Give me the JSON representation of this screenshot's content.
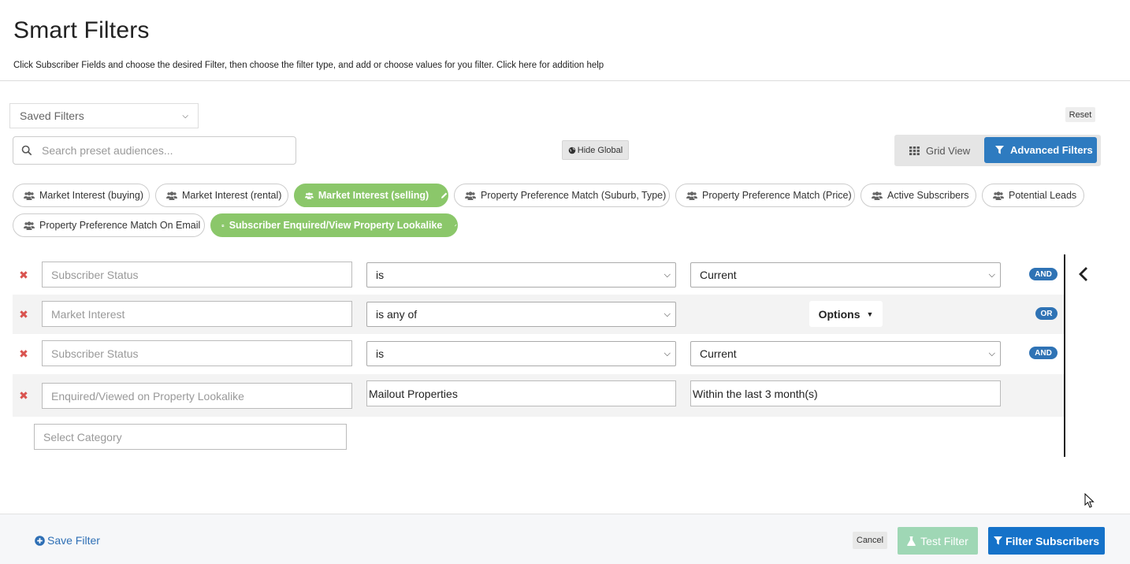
{
  "header": {
    "title": "Smart Filters",
    "subtitle": "Click Subscriber Fields and choose the desired Filter, then choose the filter type, and add or choose values for you filter. Click here for addition help"
  },
  "toolbar": {
    "saved_filters": "Saved Filters",
    "reset": "Reset",
    "search_placeholder": "Search preset audiences...",
    "hide_global": "Hide Global",
    "grid_view": "Grid View",
    "advanced_filters": "Advanced Filters"
  },
  "presets": [
    {
      "label": "Market Interest (buying)",
      "active": false
    },
    {
      "label": "Market Interest (rental)",
      "active": false
    },
    {
      "label": "Market Interest (selling)",
      "active": true
    },
    {
      "label": "Property Preference Match (Suburb, Type)",
      "active": false
    },
    {
      "label": "Property Preference Match (Price)",
      "active": false
    },
    {
      "label": "Active Subscribers",
      "active": false
    },
    {
      "label": "Potential Leads",
      "active": false
    },
    {
      "label": "Property Preference Match On Email",
      "active": false
    },
    {
      "label": "Subscriber Enquired/View Property Lookalike",
      "active": true
    }
  ],
  "rules": [
    {
      "field": "Subscriber Status",
      "operator": "is",
      "value": "Current",
      "logic": "AND"
    },
    {
      "field": "Market Interest",
      "operator": "is any of",
      "value": "Options",
      "logic": "OR"
    },
    {
      "field": "Subscriber Status",
      "operator": "is",
      "value": "Current",
      "logic": "AND"
    },
    {
      "field": "Enquired/Viewed on Property Lookalike",
      "operator": "Mailout Properties",
      "value": "Within the last 3 month(s)",
      "logic": ""
    }
  ],
  "select_category_placeholder": "Select Category",
  "footer": {
    "save_filter": "Save Filter",
    "cancel": "Cancel",
    "test_filter": "Test Filter",
    "filter_subscribers": "Filter Subscribers"
  },
  "colors": {
    "primary": "#2e7bc0",
    "chip_active": "#8bc76a",
    "delete": "#d9534f",
    "logic_badge": "#2f73b5",
    "test_button": "#9fd7b5"
  }
}
